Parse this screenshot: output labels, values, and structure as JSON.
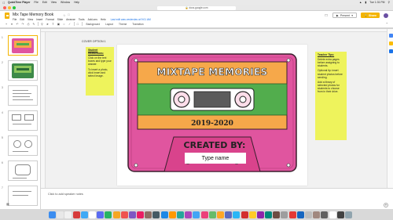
{
  "mac_menubar": {
    "app": "QuickTime Player",
    "menus": [
      "File",
      "Edit",
      "View",
      "Window",
      "Help"
    ],
    "clock": "Tue 1:31 PM"
  },
  "browser": {
    "url": "docs.google.com"
  },
  "doc": {
    "title": "Mix Tape Memory Book",
    "menus": [
      "File",
      "Edit",
      "View",
      "Insert",
      "Format",
      "Slide",
      "Arrange",
      "Tools",
      "Add-ons",
      "Help"
    ],
    "last_edit": "Last edit was yesterday at 9:01 AM",
    "present_label": "Present",
    "share_label": "Share"
  },
  "toolbar": {
    "buttons": [
      "Background",
      "Layout",
      "Theme",
      "Transition"
    ]
  },
  "filmstrip": {
    "slide_numbers": [
      "1",
      "2",
      "3",
      "4",
      "5",
      "6",
      "7"
    ]
  },
  "slide": {
    "cover_label": "COVER OPTION 1",
    "tape_title": "MIXTAPE MEMORIES",
    "year": "2019-2020",
    "created_by": "CREATED BY:",
    "name_box": "Type name"
  },
  "student_note": {
    "heading": "Student Instructions:",
    "p1": "Click on the text boxes and type your answer.",
    "p2": "To insert a photo, click Insert and select Image."
  },
  "teacher_note": {
    "heading": "Teacher Tips:",
    "p1": "Delete extra pages before assigning to students.",
    "p2": "Optional tip: insert student photos before sending.",
    "p3": "Add a library of selected photos for students to choose from in their drive."
  },
  "notes": {
    "placeholder": "Click to add speaker notes"
  },
  "colors": {
    "accent": "#f4b400",
    "tape_pink": "#e0559f",
    "tape_orange": "#f6a84a",
    "tape_green": "#52ad4d",
    "sticky_yellow": "#eef35c"
  },
  "dock": {
    "icon_colors": [
      "#3c8df0",
      "#e8e8e8",
      "#f1f1f1",
      "#d63b3b",
      "#3fa9f5",
      "#ffffff",
      "#5b6cf2",
      "#28b463",
      "#f5a623",
      "#ef5350",
      "#7e57c2",
      "#e91e63",
      "#8d6e63",
      "#455a64",
      "#1e88e5",
      "#ff9800",
      "#26a69a",
      "#ab47bc",
      "#42a5f5",
      "#ec407a",
      "#66bb6a",
      "#ffa726",
      "#5c6bc0",
      "#29b6f6",
      "#d32f2f",
      "#ffca28",
      "#8e24aa",
      "#00897b",
      "#6d4c41",
      "#9e9e9e",
      "#e53935",
      "#1565c0",
      "#bdbdbd",
      "#a1887f",
      "#616161",
      "#ffffff",
      "#424242",
      "#90a4ae"
    ]
  }
}
